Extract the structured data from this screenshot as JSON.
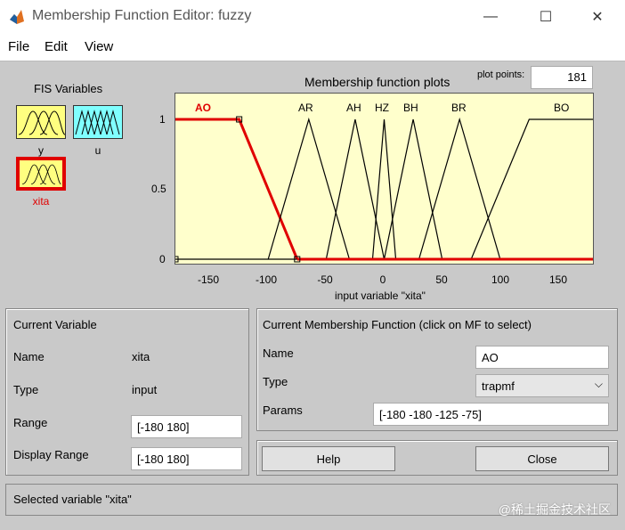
{
  "window": {
    "title": "Membership Function Editor: fuzzy",
    "minimize_glyph": "—",
    "maximize_glyph": "☐",
    "close_glyph": "✕"
  },
  "menu": {
    "file": "File",
    "edit": "Edit",
    "view": "View"
  },
  "fis_variables": {
    "label": "FIS Variables",
    "inputs": [
      {
        "name": "y"
      },
      {
        "name": "xita"
      }
    ],
    "outputs": [
      {
        "name": "u"
      }
    ],
    "selected": "xita"
  },
  "plot": {
    "title": "Membership function plots",
    "plot_points_label": "plot points:",
    "plot_points_value": "181",
    "xlabel": "input variable \"xita\"",
    "xlim": [
      -180,
      180
    ],
    "ylim": [
      0,
      1
    ],
    "xticks": [
      "-150",
      "-100",
      "-50",
      "0",
      "50",
      "100",
      "150"
    ],
    "yticks": [
      "0",
      "0.5",
      "1"
    ],
    "selected_mf": "AO",
    "colors": {
      "selected": "#e00000",
      "normal": "#000000",
      "bg": "#ffffcc"
    },
    "mfs": [
      {
        "name": "AO",
        "type": "trapmf",
        "params": [
          -180,
          -180,
          -125,
          -75
        ]
      },
      {
        "name": "AR",
        "type": "trimf",
        "params": [
          -100,
          -65,
          -30
        ]
      },
      {
        "name": "AH",
        "type": "trimf",
        "params": [
          -50,
          -25,
          0
        ]
      },
      {
        "name": "HZ",
        "type": "trimf",
        "params": [
          -10,
          0,
          10
        ]
      },
      {
        "name": "BH",
        "type": "trimf",
        "params": [
          0,
          25,
          50
        ]
      },
      {
        "name": "BR",
        "type": "trimf",
        "params": [
          30,
          65,
          100
        ]
      },
      {
        "name": "BO",
        "type": "trapmf",
        "params": [
          75,
          125,
          180,
          180
        ]
      }
    ]
  },
  "current_variable": {
    "header": "Current Variable",
    "name_label": "Name",
    "name_value": "xita",
    "type_label": "Type",
    "type_value": "input",
    "range_label": "Range",
    "range_value": "[-180 180]",
    "display_range_label": "Display Range",
    "display_range_value": "[-180 180]"
  },
  "current_mf": {
    "header": "Current Membership Function (click on MF to select)",
    "name_label": "Name",
    "name_value": "AO",
    "type_label": "Type",
    "type_value": "trapmf",
    "params_label": "Params",
    "params_value": "[-180 -180 -125 -75]"
  },
  "buttons": {
    "help": "Help",
    "close": "Close"
  },
  "status": "Selected variable \"xita\"",
  "watermark": "@稀土掘金技术社区"
}
